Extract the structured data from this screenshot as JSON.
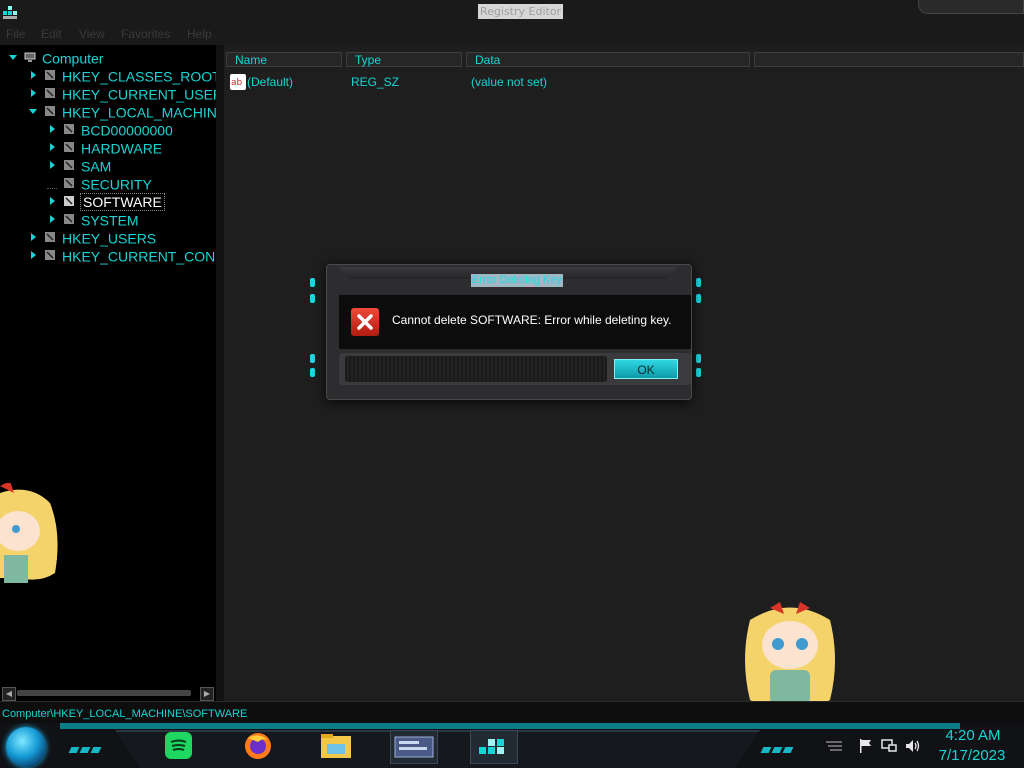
{
  "window": {
    "title": "Registry Editor"
  },
  "menu": [
    "File",
    "Edit",
    "View",
    "Favorites",
    "Help"
  ],
  "tree": {
    "items": [
      {
        "label": "Computer",
        "level": 0
      },
      {
        "label": "HKEY_CLASSES_ROOT",
        "level": 1
      },
      {
        "label": "HKEY_CURRENT_USER",
        "level": 1
      },
      {
        "label": "HKEY_LOCAL_MACHINE",
        "level": 1
      },
      {
        "label": "BCD00000000",
        "level": 2
      },
      {
        "label": "HARDWARE",
        "level": 2
      },
      {
        "label": "SAM",
        "level": 2
      },
      {
        "label": "SECURITY",
        "level": 2
      },
      {
        "label": "SOFTWARE",
        "level": 2,
        "selected": true
      },
      {
        "label": "SYSTEM",
        "level": 2
      },
      {
        "label": "HKEY_USERS",
        "level": 1
      },
      {
        "label": "HKEY_CURRENT_CONFI",
        "level": 1
      }
    ]
  },
  "list": {
    "columns": [
      "Name",
      "Type",
      "Data"
    ],
    "rows": [
      {
        "name": "(Default)",
        "type": "REG_SZ",
        "data": "(value not set)"
      }
    ]
  },
  "status": {
    "path": "Computer\\HKEY_LOCAL_MACHINE\\SOFTWARE"
  },
  "dialog": {
    "title": "Error Deleting Key",
    "message": "Cannot delete SOFTWARE:  Error while deleting key.",
    "ok_label": "OK"
  },
  "taskbar": {
    "apps": [
      "spotify-icon",
      "firefox-icon",
      "file-explorer-icon",
      "window-preview-icon",
      "registry-editor-icon"
    ],
    "clock": {
      "time": "4:20 AM",
      "date": "7/17/2023"
    }
  },
  "colors": {
    "accent": "#19d4d4",
    "error": "#d9342a"
  }
}
